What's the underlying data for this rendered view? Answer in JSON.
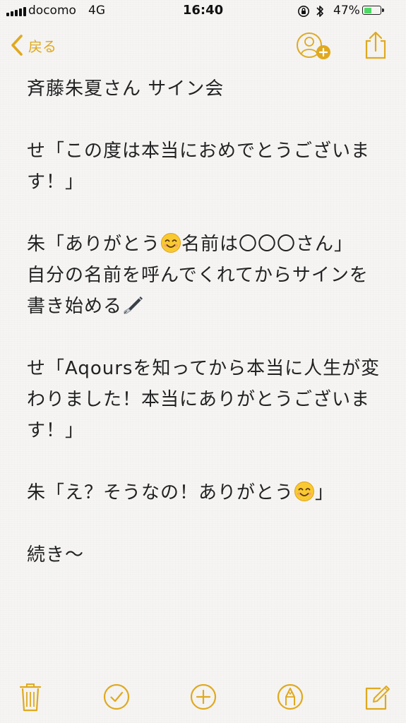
{
  "status_bar": {
    "carrier": "docomo",
    "network": "4G",
    "time": "16:40",
    "battery_percent": "47%",
    "battery_level": 0.47,
    "signal_bars": 5
  },
  "nav": {
    "back_label": "戻る",
    "accent_color": "#e0a91e"
  },
  "note": {
    "title": "斉藤朱夏さん サイン会",
    "paragraphs": [
      [
        "せ「この度は本当におめでとうございま",
        "す！」"
      ],
      [
        "朱「ありがとう",
        "名前は〇〇〇さん」",
        "自分の名前を呼んでくれてからサインを",
        "書き始める"
      ],
      [
        "せ「Aqoursを知ってから本当に人生が変",
        "わりました！本当にありがとうございま",
        "す！」"
      ],
      [
        "朱「え？そうなの！ありがとう",
        "」"
      ],
      [
        "続き〜"
      ]
    ]
  },
  "icons": {
    "back": "chevron-left-icon",
    "add_person": "add-person-icon",
    "share": "share-icon",
    "emoji_smile": "smiling-face-icon",
    "pen": "fountain-pen-icon",
    "trash": "trash-icon",
    "check": "checkmark-icon",
    "add": "plus-icon",
    "markup": "markup-pen-icon",
    "compose": "compose-icon"
  }
}
